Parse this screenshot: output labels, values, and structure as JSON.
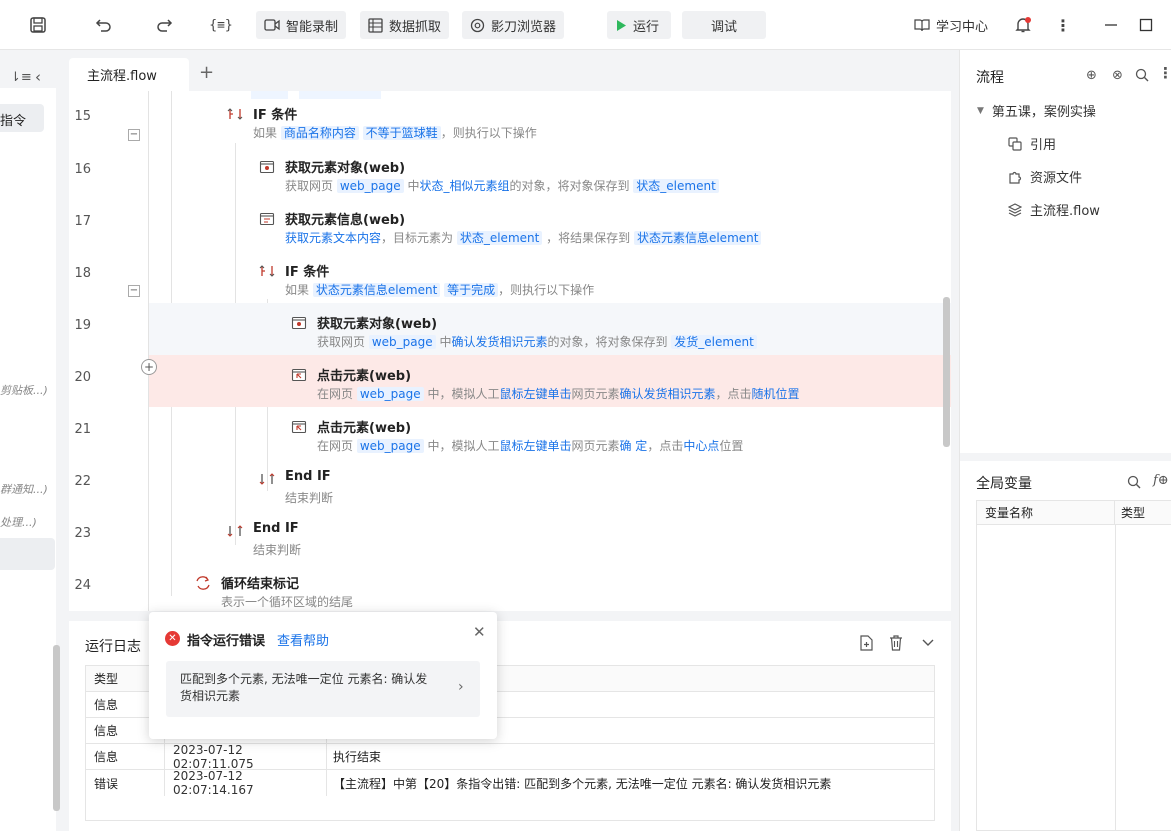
{
  "toolbar": {
    "smart_record": "智能录制",
    "data_capture": "数据抓取",
    "browser": "影刀浏览器",
    "run": "运行",
    "debug": "调试",
    "learn": "学习中心"
  },
  "left_sidebar": {
    "panel_item": "指令",
    "fragments": [
      "剪贴板...)",
      "群通知...)",
      "处理...)"
    ]
  },
  "tabs": {
    "active": "主流程.flow",
    "add": "+"
  },
  "editor": {
    "rows": [
      {
        "line": "15",
        "title": "IF 条件",
        "desc": [
          [
            "如果 ",
            ""
          ],
          [
            "商品名称内容",
            "tok"
          ],
          [
            " ",
            ""
          ],
          [
            "不等于篮球鞋",
            "tok"
          ],
          [
            "，则执行以下操作",
            ""
          ]
        ]
      },
      {
        "line": "16",
        "title": "获取元素对象(web)",
        "desc": [
          [
            "获取网页 ",
            ""
          ],
          [
            "web_page",
            "tok"
          ],
          [
            " 中",
            ""
          ],
          [
            "状态_相似元素组",
            "blue"
          ],
          [
            "的对象，将对象保存到 ",
            ""
          ],
          [
            "状态_element",
            "tok"
          ]
        ]
      },
      {
        "line": "17",
        "title": "获取元素信息(web)",
        "desc": [
          [
            "获取元素文本内容",
            "blue"
          ],
          [
            "，目标元素为 ",
            ""
          ],
          [
            "状态_element",
            "tok"
          ],
          [
            " ，将结果保存到 ",
            ""
          ],
          [
            "状态元素信息element",
            "tok"
          ]
        ]
      },
      {
        "line": "18",
        "title": "IF 条件",
        "desc": [
          [
            "如果 ",
            ""
          ],
          [
            "状态元素信息element",
            "tok"
          ],
          [
            " ",
            ""
          ],
          [
            "等于完成",
            "tok"
          ],
          [
            "，则执行以下操作",
            ""
          ]
        ]
      },
      {
        "line": "19",
        "title": "获取元素对象(web)",
        "desc": [
          [
            "获取网页 ",
            ""
          ],
          [
            "web_page",
            "tok"
          ],
          [
            " 中",
            ""
          ],
          [
            "确认发货相识元素",
            "blue"
          ],
          [
            "的对象，将对象保存到 ",
            ""
          ],
          [
            "发货_element",
            "tok"
          ]
        ]
      },
      {
        "line": "20",
        "title": "点击元素(web)",
        "desc": [
          [
            "在网页 ",
            ""
          ],
          [
            "web_page",
            "tok"
          ],
          [
            " 中，模拟人工",
            ""
          ],
          [
            "鼠标左键单击",
            "blue"
          ],
          [
            "网页元素",
            ""
          ],
          [
            "确认发货相识元素",
            "blue"
          ],
          [
            "，点击",
            ""
          ],
          [
            "随机位置",
            "blue"
          ]
        ]
      },
      {
        "line": "21",
        "title": "点击元素(web)",
        "desc": [
          [
            "在网页 ",
            ""
          ],
          [
            "web_page",
            "tok"
          ],
          [
            " 中，模拟人工",
            ""
          ],
          [
            "鼠标左键单击",
            "blue"
          ],
          [
            "网页元素",
            ""
          ],
          [
            "确 定",
            "blue"
          ],
          [
            "，点击",
            ""
          ],
          [
            "中心点",
            "blue"
          ],
          [
            "位置",
            ""
          ]
        ]
      },
      {
        "line": "22",
        "title": "End IF",
        "desc": [
          [
            "结束判断",
            ""
          ]
        ]
      },
      {
        "line": "23",
        "title": "End IF",
        "desc": [
          [
            "结束判断",
            ""
          ]
        ]
      },
      {
        "line": "24",
        "title": "循环结束标记",
        "desc": [
          [
            "表示一个循环区域的结尾",
            ""
          ]
        ]
      }
    ]
  },
  "log": {
    "title": "运行日志",
    "col_type": "类型",
    "rows": [
      {
        "type": "信息",
        "time": "",
        "msg": ""
      },
      {
        "type": "信息",
        "time": "",
        "msg": ""
      },
      {
        "type": "信息",
        "time": "2023-07-12 02:07:11.075",
        "msg": "执行结束"
      },
      {
        "type": "错误",
        "time": "2023-07-12 02:07:14.167",
        "msg": "【主流程】中第【20】条指令出错:  匹配到多个元素, 无法唯一定位 元素名: 确认发货相识元素"
      }
    ]
  },
  "error_popup": {
    "title": "指令运行错误",
    "help": "查看帮助",
    "message": "匹配到多个元素, 无法唯一定位 元素名: 确认发货相识元素"
  },
  "flow_panel": {
    "title": "流程",
    "project": "第五课，案例实操",
    "items": [
      "引用",
      "资源文件",
      "主流程.flow"
    ]
  },
  "vars_panel": {
    "title": "全局变量",
    "col_name": "变量名称",
    "col_type": "类型"
  },
  "colors": {
    "accent": "#1a73e8",
    "error": "#e53935",
    "row_error": "#fde9e7",
    "run_green": "#2eb85c"
  }
}
